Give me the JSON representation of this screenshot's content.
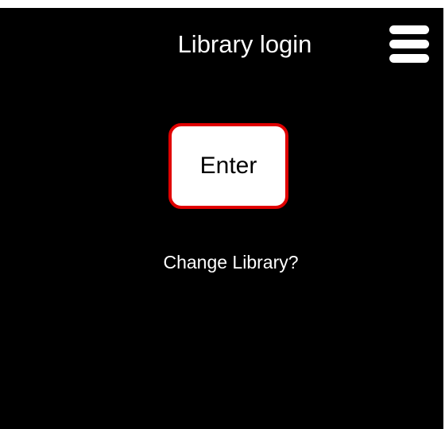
{
  "header": {
    "title": "Library login",
    "menu_icon": "hamburger-menu-icon"
  },
  "main": {
    "enter_label": "Enter",
    "change_library_label": "Change Library?"
  },
  "colors": {
    "background": "#000000",
    "text": "#ffffff",
    "button_background": "#ffffff",
    "button_border": "#e00000"
  }
}
